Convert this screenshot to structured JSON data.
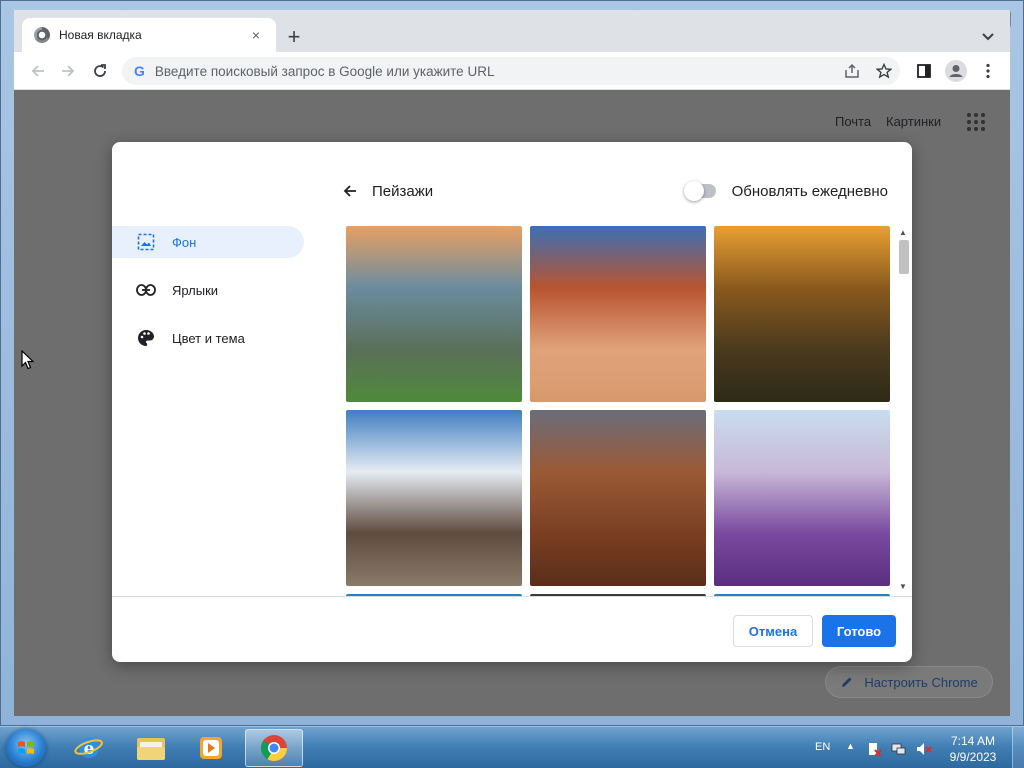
{
  "window": {
    "controls": {
      "minimize": "—",
      "maximize": "▢",
      "close": "✕"
    }
  },
  "browser": {
    "tab": {
      "title": "Новая вкладка",
      "close": "×",
      "favicon": "chrome-favicon"
    },
    "new_tab": "+",
    "omnibox": {
      "placeholder": "Введите поисковый запрос в Google или укажите URL",
      "logo": "G"
    }
  },
  "ntp": {
    "links": [
      "Почта",
      "Картинки"
    ],
    "customize_label": "Настроить Chrome"
  },
  "dialog": {
    "sidebar": [
      {
        "label": "Фон",
        "icon": "image-icon",
        "active": true
      },
      {
        "label": "Ярлыки",
        "icon": "link-icon",
        "active": false
      },
      {
        "label": "Цвет и тема",
        "icon": "palette-icon",
        "active": false
      }
    ],
    "title": "Пейзажи",
    "daily_refresh_label": "Обновлять ежедневно",
    "daily_refresh_on": false,
    "backgrounds": [
      {
        "name": "lake-rocks",
        "colors": [
          "#e8a064",
          "#6b8c9e",
          "#5b6f5a",
          "#4e8a3a"
        ]
      },
      {
        "name": "delicate-arch",
        "colors": [
          "#3b6fb5",
          "#b8542f",
          "#e0a27a",
          "#d89a6c"
        ]
      },
      {
        "name": "canyon-sunset",
        "colors": [
          "#e8a032",
          "#8a5a1e",
          "#4a3a1e",
          "#2e2a16"
        ]
      },
      {
        "name": "snowy-peak",
        "colors": [
          "#3f7ec0",
          "#e6ecf3",
          "#5e4b3f",
          "#8a7a68"
        ]
      },
      {
        "name": "desert-canyon",
        "colors": [
          "#6a6d7a",
          "#9b5a36",
          "#7a3f22",
          "#5a2e1a"
        ]
      },
      {
        "name": "lavender-field",
        "colors": [
          "#c9ddef",
          "#c8b8d8",
          "#7a4aa0",
          "#5a2e80"
        ]
      }
    ],
    "cancel_label": "Отмена",
    "done_label": "Готово"
  },
  "taskbar": {
    "apps": [
      "internet-explorer",
      "file-explorer",
      "media-player",
      "chrome"
    ],
    "language": "EN",
    "time": "7:14 AM",
    "date": "9/9/2023"
  },
  "colors": {
    "accent": "#1a73e8",
    "active_bg": "#e8f0fe",
    "overlay": "#6e6e6e"
  }
}
